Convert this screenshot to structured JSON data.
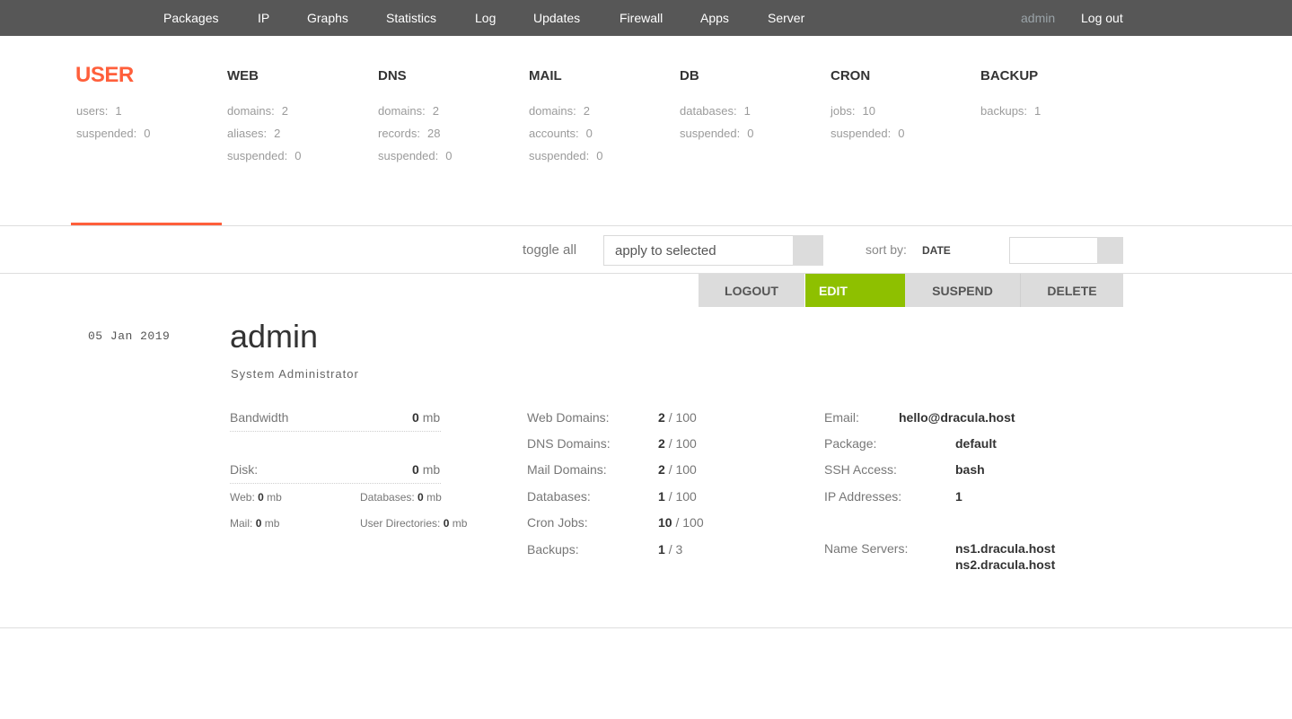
{
  "topnav": {
    "items": [
      "Packages",
      "IP",
      "Graphs",
      "Statistics",
      "Log",
      "Updates",
      "Firewall",
      "Apps",
      "Server"
    ],
    "user": "admin",
    "logout": "Log out"
  },
  "stats": [
    {
      "title": "USER",
      "active": true,
      "lines": [
        {
          "label": "users:",
          "value": "1"
        },
        {
          "label": "suspended:",
          "value": "0"
        }
      ]
    },
    {
      "title": "WEB",
      "lines": [
        {
          "label": "domains:",
          "value": "2"
        },
        {
          "label": "aliases:",
          "value": "2"
        },
        {
          "label": "suspended:",
          "value": "0"
        }
      ]
    },
    {
      "title": "DNS",
      "lines": [
        {
          "label": "domains:",
          "value": "2"
        },
        {
          "label": "records:",
          "value": "28"
        },
        {
          "label": "suspended:",
          "value": "0"
        }
      ]
    },
    {
      "title": "MAIL",
      "lines": [
        {
          "label": "domains:",
          "value": "2"
        },
        {
          "label": "accounts:",
          "value": "0"
        },
        {
          "label": "suspended:",
          "value": "0"
        }
      ]
    },
    {
      "title": "DB",
      "lines": [
        {
          "label": "databases:",
          "value": "1"
        },
        {
          "label": "suspended:",
          "value": "0"
        }
      ]
    },
    {
      "title": "CRON",
      "lines": [
        {
          "label": "jobs:",
          "value": "10"
        },
        {
          "label": "suspended:",
          "value": "0"
        }
      ]
    },
    {
      "title": "BACKUP",
      "lines": [
        {
          "label": "backups:",
          "value": "1"
        }
      ]
    }
  ],
  "toolbar": {
    "toggle_all": "toggle all",
    "apply_placeholder": "apply to selected",
    "sort_label": "sort by:",
    "sort_value": "DATE"
  },
  "actions": [
    "LOGOUT",
    "EDIT",
    "SUSPEND",
    "DELETE"
  ],
  "record": {
    "date": "05  Jan  2019",
    "name": "admin",
    "role": "System Administrator",
    "bandwidth": {
      "label": "Bandwidth",
      "value": "0",
      "unit": "mb"
    },
    "disk": {
      "label": "Disk:",
      "value": "0",
      "unit": "mb"
    },
    "disk_breakdown": [
      {
        "label": "Web:",
        "value": "0",
        "unit": "mb"
      },
      {
        "label": "Databases:",
        "value": "0",
        "unit": "mb"
      },
      {
        "label": "Mail:",
        "value": "0",
        "unit": "mb"
      },
      {
        "label": "User Directories:",
        "value": "0",
        "unit": "mb"
      }
    ],
    "limits": [
      {
        "label": "Web Domains:",
        "used": "2",
        "max": "/ 100"
      },
      {
        "label": "DNS Domains:",
        "used": "2",
        "max": "/ 100"
      },
      {
        "label": "Mail Domains:",
        "used": "2",
        "max": "/ 100"
      },
      {
        "label": "Databases:",
        "used": "1",
        "max": "/ 100"
      },
      {
        "label": "Cron Jobs:",
        "used": "10",
        "max": "/ 100"
      },
      {
        "label": "Backups:",
        "used": "1",
        "max": "/ 3"
      }
    ],
    "info": {
      "email_label": "Email:",
      "email": "hello@dracula.host",
      "package_label": "Package:",
      "package": "default",
      "ssh_label": "SSH Access:",
      "ssh": "bash",
      "ip_label": "IP Addresses:",
      "ip": "1",
      "ns_label": "Name Servers:",
      "ns1": "ns1.dracula.host",
      "ns2": "ns2.dracula.host"
    }
  },
  "colors": {
    "accent": "#ff5f3b",
    "edit": "#8ec000",
    "nav_bg": "#575757"
  }
}
